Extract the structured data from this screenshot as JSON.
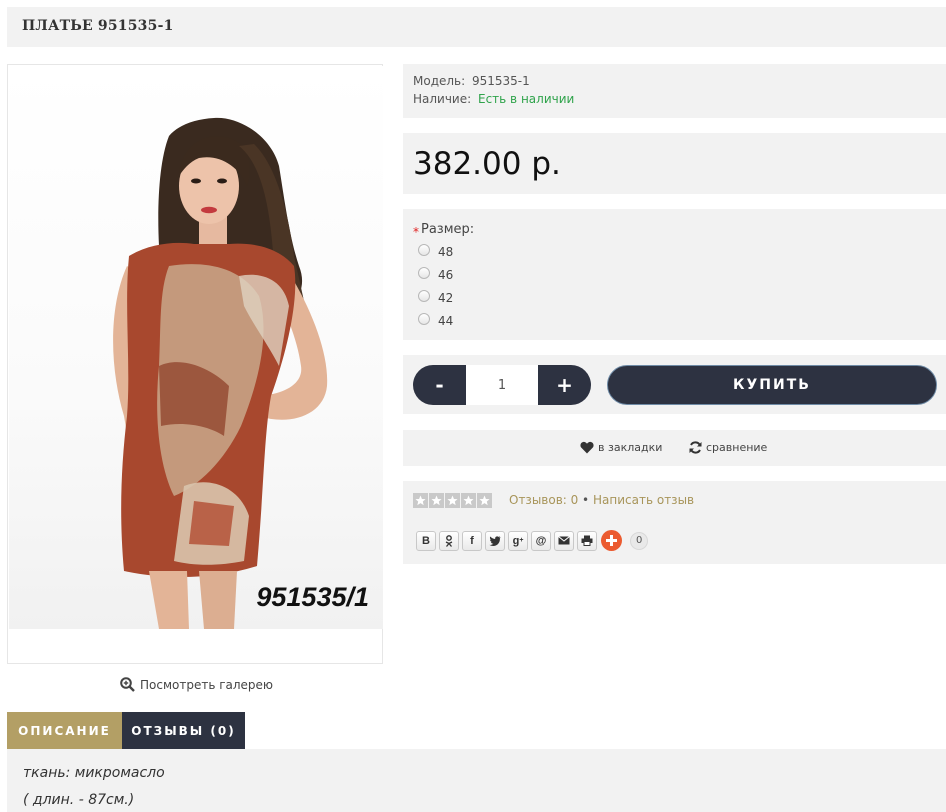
{
  "product": {
    "title": "ПЛАТЬЕ 951535-1",
    "image_code": "951535/1",
    "gallery_link": "Посмотреть галерею",
    "model_label": "Модель:",
    "model_value": "951535-1",
    "availability_label": "Наличие:",
    "availability_value": "Есть в наличии",
    "price": "382.00 р."
  },
  "options": {
    "required_mark": "*",
    "size_label": "Размер:",
    "sizes": [
      "48",
      "46",
      "42",
      "44"
    ]
  },
  "cart": {
    "minus_label": "-",
    "plus_label": "+",
    "quantity": "1",
    "buy_label": "КУПИТЬ"
  },
  "actions": {
    "wishlist_label": "в закладки",
    "compare_label": "сравнение"
  },
  "reviews": {
    "rating": 0,
    "rating_max": 5,
    "count_label": "Отзывов: 0",
    "separator": "•",
    "write_label": "Написать отзыв"
  },
  "share": {
    "buttons": [
      "vk-icon",
      "odnoklassniki-icon",
      "facebook-icon",
      "twitter-icon",
      "google-plus-icon",
      "mail-at-icon",
      "email-icon",
      "print-icon"
    ],
    "count": "0"
  },
  "tabs": [
    {
      "label": "ОПИСАНИЕ",
      "active": true
    },
    {
      "label": "ОТЗЫВЫ (0)",
      "active": false
    }
  ],
  "description": {
    "line1": "ткань: микромасло",
    "line2": "( длин. - 87см.)"
  },
  "colors": {
    "accent_gold": "#b39f65",
    "dark_navy": "#2d3241",
    "in_stock_green": "#2fa34b",
    "panel_bg": "#f2f2f2",
    "share_plus": "#eb5b30"
  }
}
